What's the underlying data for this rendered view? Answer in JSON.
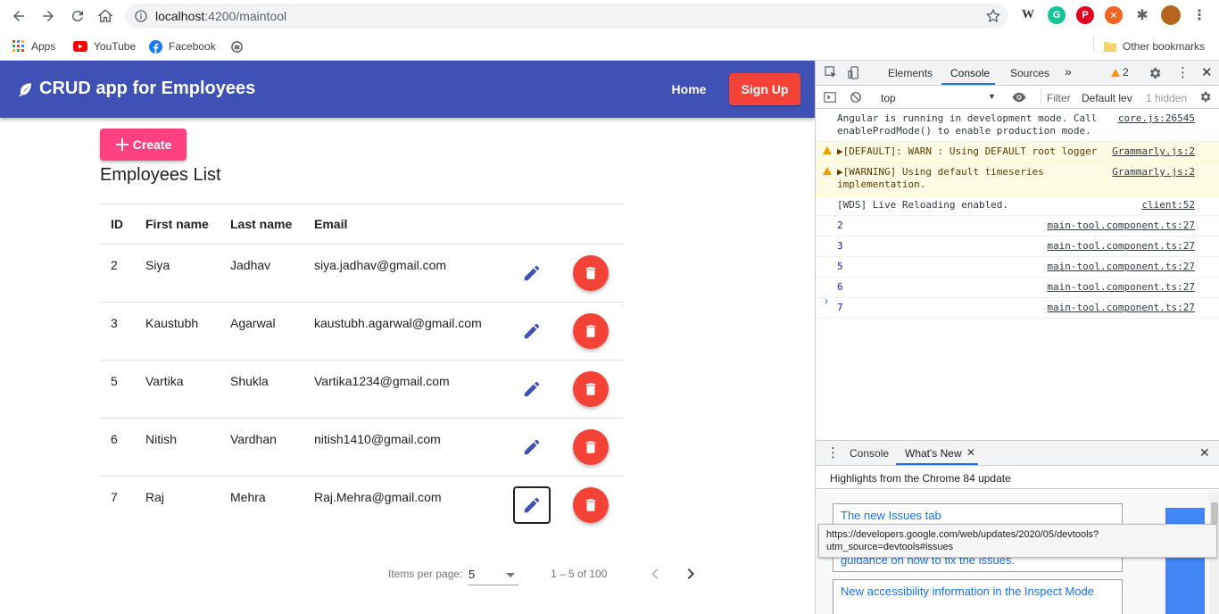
{
  "browser": {
    "url_host": "localhost",
    "url_path": ":4200/maintool",
    "bookmarks": [
      "Apps",
      "YouTube",
      "Facebook"
    ],
    "other_bookmarks": "Other bookmarks",
    "extension_w": "W"
  },
  "app": {
    "title": "CRUD app for Employees",
    "nav_home": "Home",
    "nav_signup": "Sign Up",
    "create_label": "Create",
    "list_title": "Employees List",
    "columns": [
      "ID",
      "First name",
      "Last name",
      "Email"
    ],
    "rows": [
      {
        "id": "2",
        "first": "Siya",
        "last": "Jadhav",
        "email": "siya.jadhav@gmail.com"
      },
      {
        "id": "3",
        "first": "Kaustubh",
        "last": "Agarwal",
        "email": "kaustubh.agarwal@gmail.com"
      },
      {
        "id": "5",
        "first": "Vartika",
        "last": "Shukla",
        "email": "Vartika1234@gmail.com"
      },
      {
        "id": "6",
        "first": "Nitish",
        "last": "Vardhan",
        "email": "nitish1410@gmail.com"
      },
      {
        "id": "7",
        "first": "Raj",
        "last": "Mehra",
        "email": "Raj.Mehra@gmail.com"
      }
    ],
    "paginator": {
      "items_per_page_label": "Items per page:",
      "page_size": "5",
      "range": "1 – 5 of 100"
    }
  },
  "devtools": {
    "tabs": [
      "Elements",
      "Console",
      "Sources"
    ],
    "active_tab": "Console",
    "warning_count": "2",
    "context": "top",
    "filter_placeholder": "Filter",
    "levels": "Default lev",
    "hidden": "1 hidden",
    "console_lines": [
      {
        "text": "Angular is running in development mode. Call enableProdMode() to enable production mode.",
        "src": "core.js:26545",
        "type": "log"
      },
      {
        "text": "▶[DEFAULT]: WARN : Using DEFAULT root logger",
        "src": "Grammarly.js:2",
        "type": "warn"
      },
      {
        "text": "▶[WARNING] Using default timeseries implementation.",
        "src": "Grammarly.js:2",
        "type": "warn"
      },
      {
        "text": "[WDS] Live Reloading enabled.",
        "src": "client:52",
        "type": "log"
      },
      {
        "text": "2",
        "src": "main-tool.component.ts:27",
        "type": "num"
      },
      {
        "text": "3",
        "src": "main-tool.component.ts:27",
        "type": "num"
      },
      {
        "text": "5",
        "src": "main-tool.component.ts:27",
        "type": "num"
      },
      {
        "text": "6",
        "src": "main-tool.component.ts:27",
        "type": "num"
      },
      {
        "text": "7",
        "src": "main-tool.component.ts:27",
        "type": "num"
      }
    ],
    "drawer_tabs": [
      "Console",
      "What's New"
    ],
    "highlights": "Highlights from the Chrome 84 update",
    "cards": [
      "The new Issues tab",
      "guidance on how to fix the issues.",
      "New accessibility information in the Inspect Mode"
    ],
    "tooltip": "https://developers.google.com/web/updates/2020/05/devtools?utm_source=devtools#issues"
  }
}
